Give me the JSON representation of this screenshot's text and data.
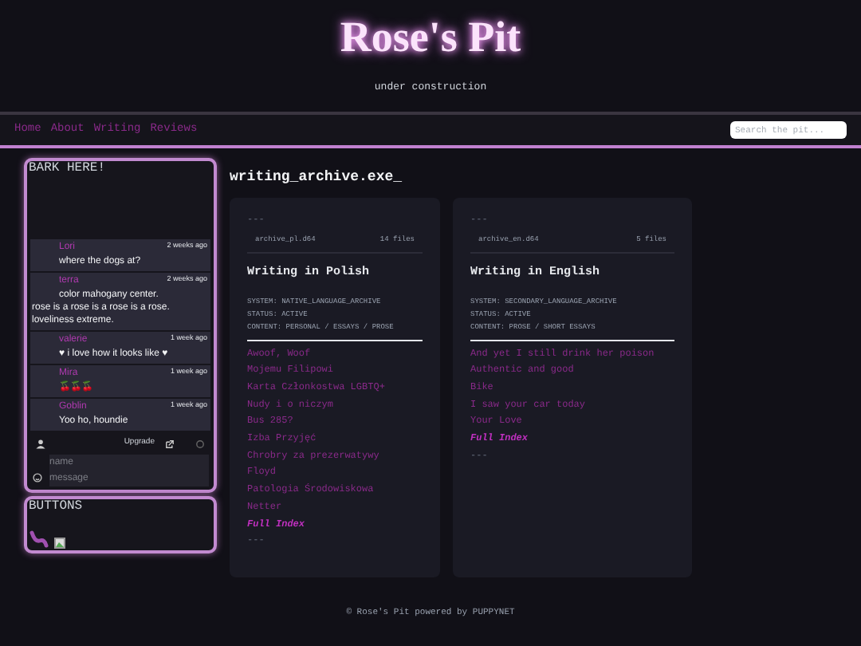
{
  "site": {
    "title": "Rose's Pit",
    "subtitle": "under construction"
  },
  "nav": {
    "links": [
      "Home",
      "About",
      "Writing",
      "Reviews"
    ],
    "search": {
      "placeholder": "Search the pit..."
    }
  },
  "chat": {
    "title": "BARK HERE!",
    "messages": [
      {
        "author": "Lori",
        "time": "2 weeks ago",
        "text": "where the dogs at?"
      },
      {
        "author": "terra",
        "time": "2 weeks ago",
        "text": "color mahogany center.\nrose is a rose is a rose is a rose.\nloveliness extreme."
      },
      {
        "author": "valerie",
        "time": "1 week ago",
        "text": "♥ i love how it looks like ♥"
      },
      {
        "author": "Mira",
        "time": "1 week ago",
        "text": "🍒🍒🍒"
      },
      {
        "author": "Goblin",
        "time": "1 week ago",
        "text": "Yoo ho, houndie"
      }
    ],
    "upgrade": "Upgrade",
    "name_field": {
      "placeholder": "name"
    },
    "message_field": {
      "placeholder": "message"
    }
  },
  "buttons_panel": {
    "title": "BUTTONS"
  },
  "main": {
    "title": "writing_archive.exe_",
    "cards": [
      {
        "top": "---",
        "file": "archive_pl.d64",
        "count": "14 files",
        "title": "Writing in Polish",
        "meta": [
          "SYSTEM: NATIVE_LANGUAGE_ARCHIVE",
          "STATUS: ACTIVE",
          "CONTENT: PERSONAL / ESSAYS / PROSE"
        ],
        "links": [
          "Awoof, Woof",
          "Mojemu Filipowi",
          "Karta Członkostwa LGBTQ+",
          "Nudy i o niczym",
          "Bus 285?",
          "Izba Przyjęć",
          "Chrobry za prezerwatywy",
          "Floyd",
          "Patologia Środowiskowa",
          "Netter"
        ],
        "index": "Full Index",
        "bottom": "---"
      },
      {
        "top": "---",
        "file": "archive_en.d64",
        "count": "5 files",
        "title": "Writing in English",
        "meta": [
          "SYSTEM: SECONDARY_LANGUAGE_ARCHIVE",
          "STATUS: ACTIVE",
          "CONTENT: PROSE / SHORT ESSAYS"
        ],
        "links": [
          "And yet I still drink her poison",
          "Authentic and good",
          "Bike",
          "I saw your car today",
          "Your Love"
        ],
        "index": "Full Index",
        "bottom": "---"
      }
    ]
  },
  "footer": "© Rose's Pit powered by PUPPYNET"
}
